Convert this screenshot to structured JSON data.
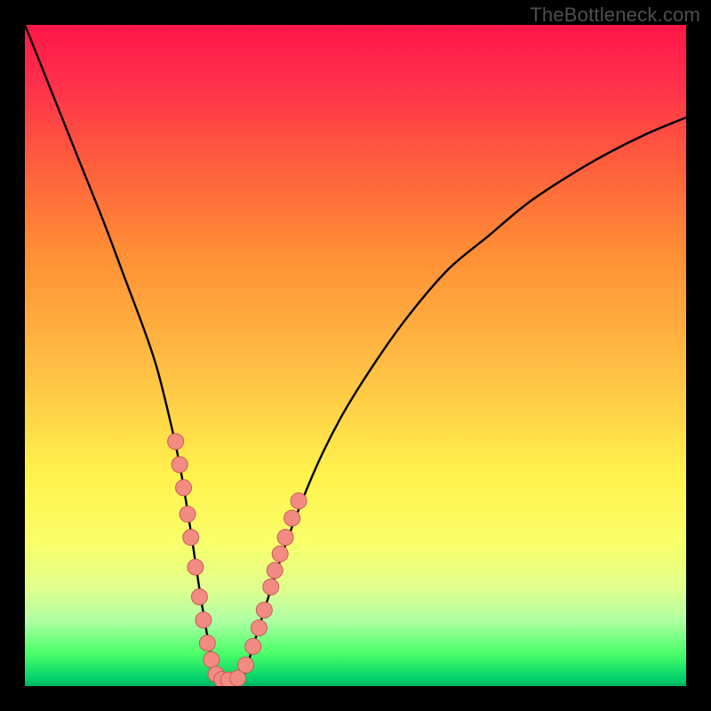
{
  "watermark": "TheBottleneck.com",
  "colors": {
    "frame": "#000000",
    "curve": "#000000",
    "dot_fill": "#f28b82",
    "dot_stroke": "#c85d5a"
  },
  "chart_data": {
    "type": "line",
    "title": "",
    "xlabel": "",
    "ylabel": "",
    "xlim": [
      0,
      100
    ],
    "ylim": [
      0,
      100
    ],
    "curve_samples": {
      "x": [
        0,
        4,
        8,
        12,
        15,
        18,
        20,
        22,
        23.5,
        25,
        27,
        29,
        31,
        33,
        34.5,
        37,
        40,
        44,
        48,
        53,
        58,
        64,
        70,
        76,
        82,
        88,
        94,
        100
      ],
      "y": [
        100,
        90,
        80,
        70,
        62,
        54,
        48,
        40,
        33,
        24,
        11,
        1.2,
        0.8,
        1.5,
        6,
        14,
        23,
        33,
        41,
        49,
        56,
        63,
        68,
        73,
        77,
        80.5,
        83.5,
        86
      ]
    },
    "marker_points": {
      "x": [
        22.8,
        23.4,
        24.0,
        24.6,
        25.1,
        25.8,
        26.4,
        27.0,
        27.6,
        28.2,
        28.9,
        29.8,
        30.8,
        32.2,
        33.4,
        34.5,
        35.4,
        36.2,
        37.2,
        37.8,
        38.6,
        39.4,
        40.4,
        41.4
      ],
      "y": [
        37.0,
        33.5,
        30.0,
        26.0,
        22.5,
        18.0,
        13.5,
        10.0,
        6.5,
        4.0,
        1.8,
        1.0,
        0.9,
        1.2,
        3.2,
        6.0,
        8.8,
        11.5,
        15.0,
        17.5,
        20.0,
        22.5,
        25.4,
        28.0
      ]
    }
  }
}
